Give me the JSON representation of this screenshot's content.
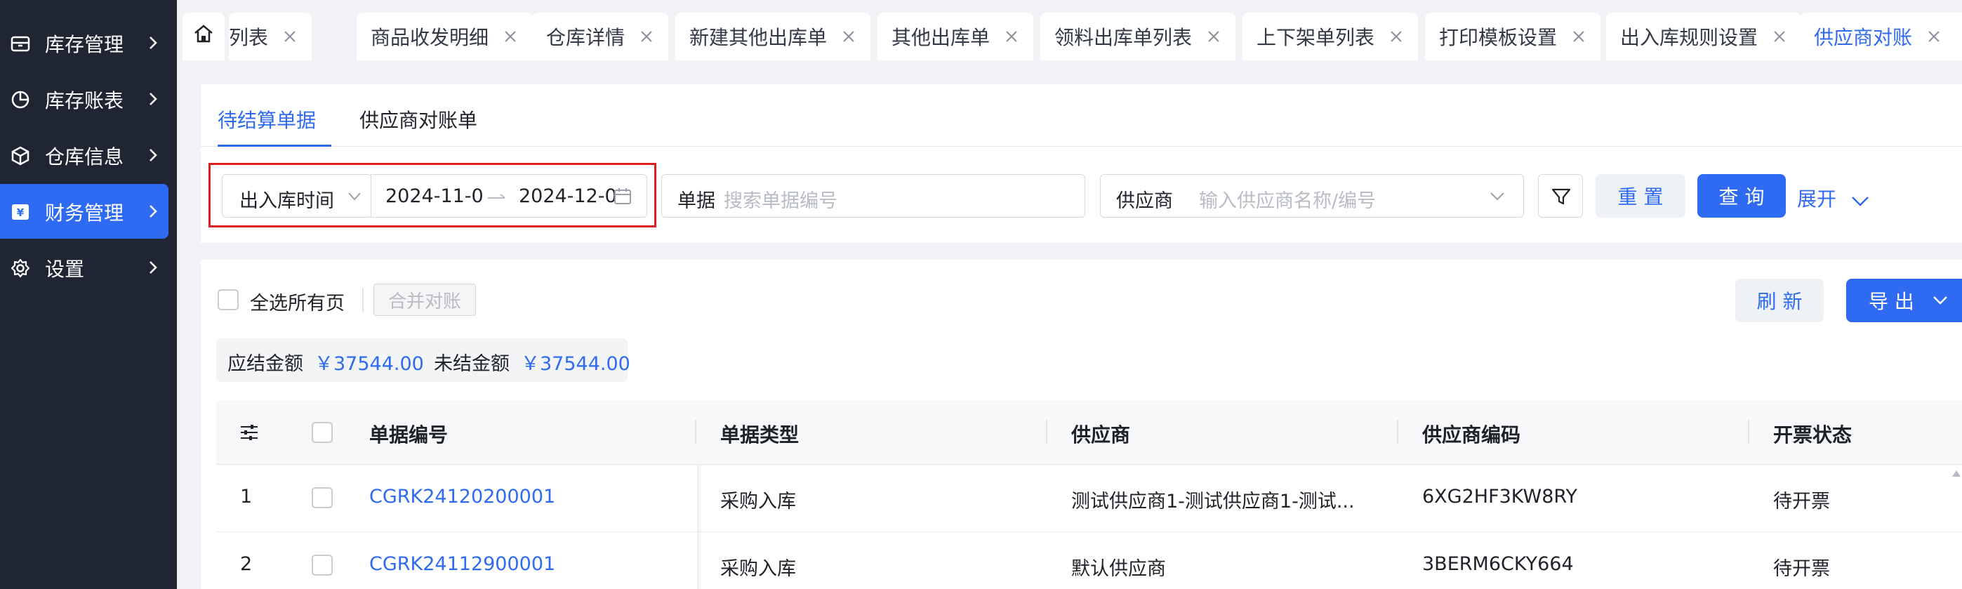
{
  "sidebar": {
    "items": [
      {
        "label": "库存管理",
        "icon": "inventory-icon",
        "active": false
      },
      {
        "label": "库存账表",
        "icon": "pie-chart-icon",
        "active": false
      },
      {
        "label": "仓库信息",
        "icon": "cube-icon",
        "active": false
      },
      {
        "label": "财务管理",
        "icon": "finance-icon",
        "active": true
      },
      {
        "label": "设置",
        "icon": "gear-icon",
        "active": false
      }
    ]
  },
  "tabs": {
    "home_icon": "home-icon",
    "items": [
      {
        "label": "列表"
      },
      {
        "label": "商品收发明细"
      },
      {
        "label": "仓库详情"
      },
      {
        "label": "新建其他出库单"
      },
      {
        "label": "其他出库单"
      },
      {
        "label": "领料出库单列表"
      },
      {
        "label": "上下架单列表"
      },
      {
        "label": "打印模板设置"
      },
      {
        "label": "出入库规则设置"
      },
      {
        "label": "供应商对账",
        "active": true
      }
    ]
  },
  "subtabs": {
    "pending": "待结算单据",
    "reconciliation": "供应商对账单"
  },
  "filters": {
    "date_type": "出入库时间",
    "date_start": "2024-11-0",
    "date_end": "2024-12-0",
    "doc_label": "单据",
    "doc_placeholder": "搜索单据编号",
    "supplier_label": "供应商",
    "supplier_placeholder": "输入供应商名称/编号",
    "reset_label": "重 置",
    "query_label": "查 询",
    "expand_label": "展开"
  },
  "toolbar": {
    "select_all_label": "全选所有页",
    "merge_label": "合并对账",
    "refresh_label": "刷 新",
    "export_label": "导 出"
  },
  "summary": {
    "due_label": "应结金额",
    "due_value": "￥37544.00",
    "unsettled_label": "未结金额",
    "unsettled_value": "￥37544.00"
  },
  "table": {
    "columns": [
      "单据编号",
      "单据类型",
      "供应商",
      "供应商编码",
      "开票状态"
    ],
    "rows": [
      {
        "index": "1",
        "doc_no": "CGRK24120200001",
        "type": "采购入库",
        "supplier": "测试供应商1-测试供应商1-测试...",
        "code": "6XG2HF3KW8RY",
        "invoice": "待开票"
      },
      {
        "index": "2",
        "doc_no": "CGRK24112900001",
        "type": "采购入库",
        "supplier": "默认供应商",
        "code": "3BERM6CKY664",
        "invoice": "待开票"
      }
    ]
  },
  "colors": {
    "primary": "#2f6bf2",
    "sidebar_bg": "#1f2532",
    "highlight": "#e02020"
  }
}
